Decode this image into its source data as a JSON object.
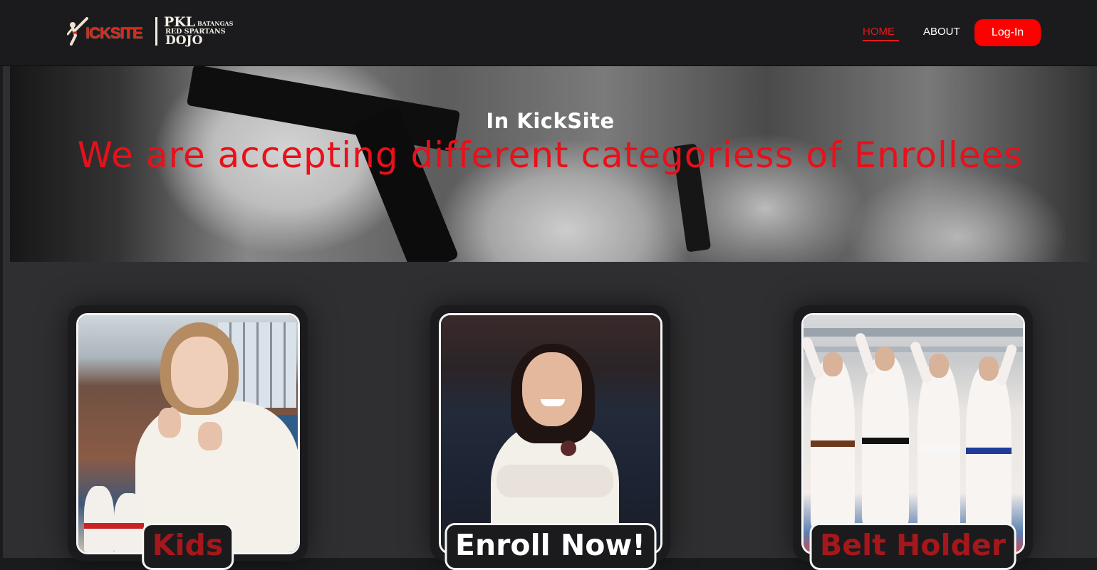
{
  "header": {
    "logo": {
      "icksite": "ICKSITE",
      "pkl": "PKL",
      "batangas": "BATANGAS",
      "red_spartans": "RED SPARTANS",
      "dojo": "DOJO"
    },
    "nav": {
      "home": "HOME",
      "about": "ABOUT",
      "login": "Log-In"
    }
  },
  "hero": {
    "subtitle": "In KickSite",
    "title": "We are accepting different categoriess of Enrollees"
  },
  "cards": [
    {
      "label": "Kids"
    },
    {
      "label": "Enroll Now!"
    },
    {
      "label": "Belt Holder"
    }
  ],
  "colors": {
    "accent_red": "#ff0000",
    "title_red": "#e8101a",
    "label_red": "#a5171b",
    "background": "#1b1b1d",
    "section": "#2f2f31"
  }
}
